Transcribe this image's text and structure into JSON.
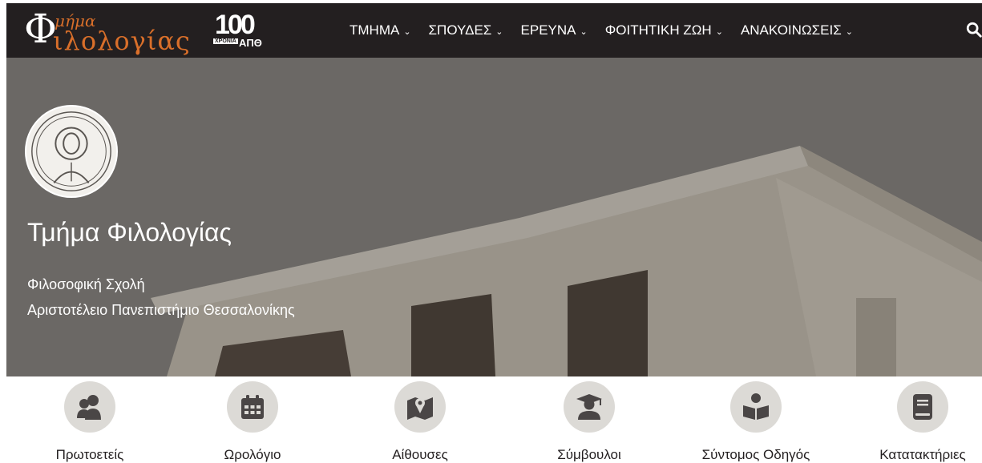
{
  "header": {
    "logo_line1": "μήμα",
    "logo_line2": "ιλολογίας",
    "logo_initial": "Φ",
    "badge_number": "100",
    "badge_sub": "ΧΡΟΝΙΑ",
    "badge_org": "ΑΠΘ",
    "nav": [
      {
        "label": "ΤΜΗΜΑ"
      },
      {
        "label": "ΣΠΟΥΔΕΣ"
      },
      {
        "label": "ΕΡΕΥΝΑ"
      },
      {
        "label": "ΦΟΙΤΗΤΙΚΗ ΖΩΗ"
      },
      {
        "label": "ΑΝΑΚΟΙΝΩΣΕΙΣ"
      }
    ],
    "search_icon": "search-icon"
  },
  "hero": {
    "title": "Τμήμα Φιλολογίας",
    "subtitle1": "Φιλοσοφική Σχολή",
    "subtitle2": "Αριστοτέλειο Πανεπιστήμιο Θεσσαλονίκης"
  },
  "quick_links": [
    {
      "label": "Πρωτοετείς",
      "icon": "users-icon"
    },
    {
      "label": "Ωρολόγιο",
      "icon": "calendar-icon"
    },
    {
      "label": "Αίθουσες",
      "icon": "map-icon"
    },
    {
      "label": "Σύμβουλοι",
      "icon": "graduate-icon"
    },
    {
      "label": "Σύντομος Οδηγός",
      "icon": "reader-icon"
    },
    {
      "label": "Κατατακτήριες",
      "icon": "book-icon"
    }
  ],
  "colors": {
    "topbar": "#231f20",
    "logo_accent": "#d96f2a",
    "icon_circle": "#dcdad6",
    "icon_glyph": "#4a4646"
  }
}
